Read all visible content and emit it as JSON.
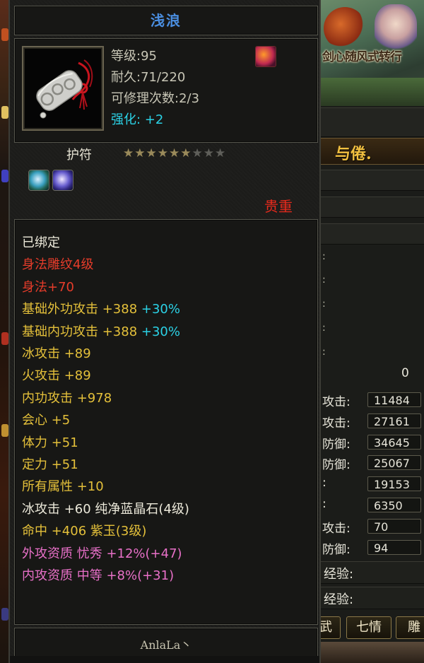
{
  "item": {
    "name": "浅浪",
    "level_text": "等级:95",
    "durability_text": "耐久:71/220",
    "repair_text": "可修理次数:2/3",
    "enhance_label": "强化:",
    "enhance_value": "+2",
    "type": "护符",
    "stars_total": 9,
    "stars_lit": 6,
    "rarity": "贵重",
    "icons": [
      "amulet-icon",
      "skill-icon",
      "gem-green-icon",
      "gem-purple-icon"
    ]
  },
  "attributes": [
    {
      "segments": [
        {
          "text": "已绑定",
          "color": "white"
        }
      ]
    },
    {
      "segments": [
        {
          "text": "身法雕纹4级",
          "color": "red"
        }
      ]
    },
    {
      "segments": [
        {
          "text": "身法+70",
          "color": "red"
        }
      ]
    },
    {
      "segments": [
        {
          "text": "基础外功攻击 +388 ",
          "color": "yellow"
        },
        {
          "text": "+30%",
          "color": "cyan"
        }
      ]
    },
    {
      "segments": [
        {
          "text": "基础内功攻击 +388 ",
          "color": "yellow"
        },
        {
          "text": "+30%",
          "color": "cyan"
        }
      ]
    },
    {
      "segments": [
        {
          "text": "冰攻击 +89",
          "color": "yellow"
        }
      ]
    },
    {
      "segments": [
        {
          "text": "火攻击 +89",
          "color": "yellow"
        }
      ]
    },
    {
      "segments": [
        {
          "text": "内功攻击 +978",
          "color": "yellow"
        }
      ]
    },
    {
      "segments": [
        {
          "text": "会心 +5",
          "color": "yellow"
        }
      ]
    },
    {
      "segments": [
        {
          "text": "体力 +51",
          "color": "yellow"
        }
      ]
    },
    {
      "segments": [
        {
          "text": "定力 +51",
          "color": "yellow"
        }
      ]
    },
    {
      "segments": [
        {
          "text": "所有属性 +10",
          "color": "yellow"
        }
      ]
    },
    {
      "segments": [
        {
          "text": "冰攻击 +60 纯净蓝晶石(4级)",
          "color": "white"
        }
      ]
    },
    {
      "segments": [
        {
          "text": "命中 +406 紫玉(3级)",
          "color": "yellow"
        }
      ]
    },
    {
      "segments": [
        {
          "text": "外攻资质  忧秀 +12%(+47)",
          "color": "pink"
        }
      ]
    },
    {
      "segments": [
        {
          "text": "内攻资质  中等 +8%(+31)",
          "color": "pink"
        }
      ]
    }
  ],
  "signature": "AnlaLa丶",
  "right_panel": {
    "banner_text": "剑心随风式转行",
    "title": "与倦.",
    "zero_value": "0",
    "stats": [
      {
        "label": "攻击:",
        "value": "11484"
      },
      {
        "label": "攻击:",
        "value": "27161"
      },
      {
        "label": "防御:",
        "value": "34645"
      },
      {
        "label": "防御:",
        "value": "25067"
      },
      {
        "label": ":",
        "value": "19153"
      },
      {
        "label": ":",
        "value": "6350"
      },
      {
        "label": "攻击:",
        "value": "70"
      },
      {
        "label": "防御:",
        "value": "94"
      }
    ],
    "exp_labels": [
      "经验:",
      "经验:"
    ],
    "tabs": [
      "武",
      "七情",
      "雕"
    ]
  },
  "colors": {
    "title_blue": "#4a8ee0",
    "red": "#e63c2a",
    "yellow": "#e4c03a",
    "cyan": "#2bd2e6",
    "pink": "#e870c8",
    "white": "#ece9da",
    "gold": "#f2c040"
  }
}
